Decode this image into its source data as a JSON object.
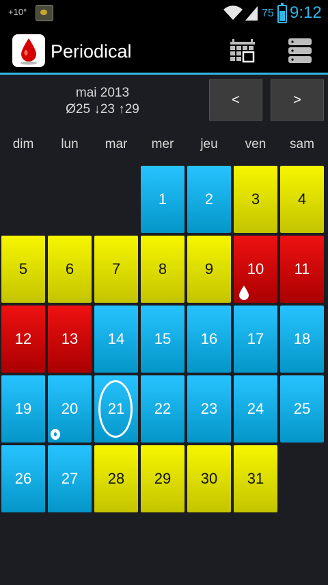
{
  "status_bar": {
    "temperature": "+10°",
    "battery": "75",
    "time": "9:12"
  },
  "app": {
    "title": "Periodical"
  },
  "header": {
    "month": "mai 2013",
    "stats": "Ø25 ↓23 ↑29",
    "prev_label": "<",
    "next_label": ">"
  },
  "weekdays": [
    "dim",
    "lun",
    "mar",
    "mer",
    "jeu",
    "ven",
    "sam"
  ],
  "legend_colors": {
    "period": "#dd0000",
    "fertile": "#e6e600",
    "normal": "#12b4ea",
    "accent": "#33b5e5"
  },
  "days": [
    {
      "day": "1",
      "status": "blue"
    },
    {
      "day": "2",
      "status": "blue"
    },
    {
      "day": "3",
      "status": "yellow"
    },
    {
      "day": "4",
      "status": "yellow"
    },
    {
      "day": "5",
      "status": "yellow"
    },
    {
      "day": "6",
      "status": "yellow"
    },
    {
      "day": "7",
      "status": "yellow"
    },
    {
      "day": "8",
      "status": "yellow"
    },
    {
      "day": "9",
      "status": "yellow"
    },
    {
      "day": "10",
      "status": "red",
      "marker": "drop-icon"
    },
    {
      "day": "11",
      "status": "red"
    },
    {
      "day": "12",
      "status": "red"
    },
    {
      "day": "13",
      "status": "red"
    },
    {
      "day": "14",
      "status": "blue"
    },
    {
      "day": "15",
      "status": "blue"
    },
    {
      "day": "16",
      "status": "blue"
    },
    {
      "day": "17",
      "status": "blue"
    },
    {
      "day": "18",
      "status": "blue"
    },
    {
      "day": "19",
      "status": "blue"
    },
    {
      "day": "20",
      "status": "blue",
      "marker": "ovulation-o-icon"
    },
    {
      "day": "21",
      "status": "blue",
      "today": true
    },
    {
      "day": "22",
      "status": "blue"
    },
    {
      "day": "23",
      "status": "blue"
    },
    {
      "day": "24",
      "status": "blue"
    },
    {
      "day": "25",
      "status": "blue"
    },
    {
      "day": "26",
      "status": "blue"
    },
    {
      "day": "27",
      "status": "blue"
    },
    {
      "day": "28",
      "status": "yellow"
    },
    {
      "day": "29",
      "status": "yellow"
    },
    {
      "day": "30",
      "status": "yellow"
    },
    {
      "day": "31",
      "status": "yellow"
    }
  ]
}
